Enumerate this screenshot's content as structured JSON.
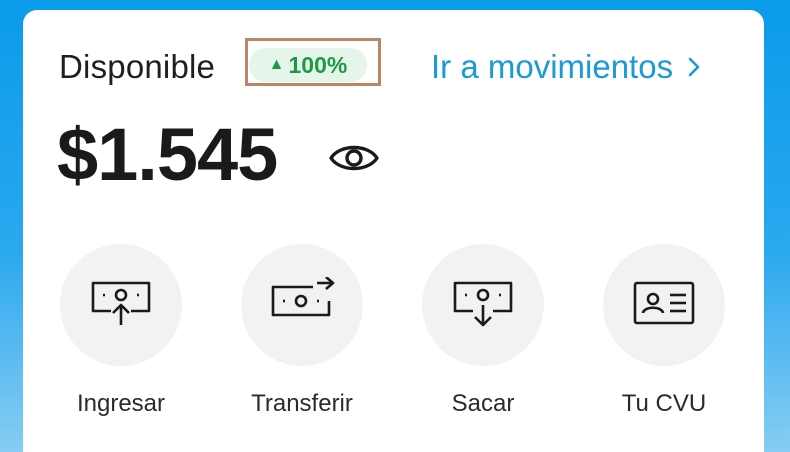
{
  "balance_card": {
    "available_label": "Disponible",
    "change_badge": {
      "arrow": "▲",
      "value": "100%",
      "color": "#1c9a45"
    },
    "movements_link": "Ir a movimientos",
    "balance": "$1.545",
    "visibility_icon": "eye-icon"
  },
  "actions": [
    {
      "label": "Ingresar",
      "icon": "money-in-icon"
    },
    {
      "label": "Transferir",
      "icon": "money-transfer-icon"
    },
    {
      "label": "Sacar",
      "icon": "money-out-icon"
    },
    {
      "label": "Tu CVU",
      "icon": "id-card-icon"
    }
  ],
  "colors": {
    "background": "#0a9bea",
    "link": "#1a9ad8",
    "positive": "#1c9a45",
    "highlight_box": "#b8876a"
  }
}
